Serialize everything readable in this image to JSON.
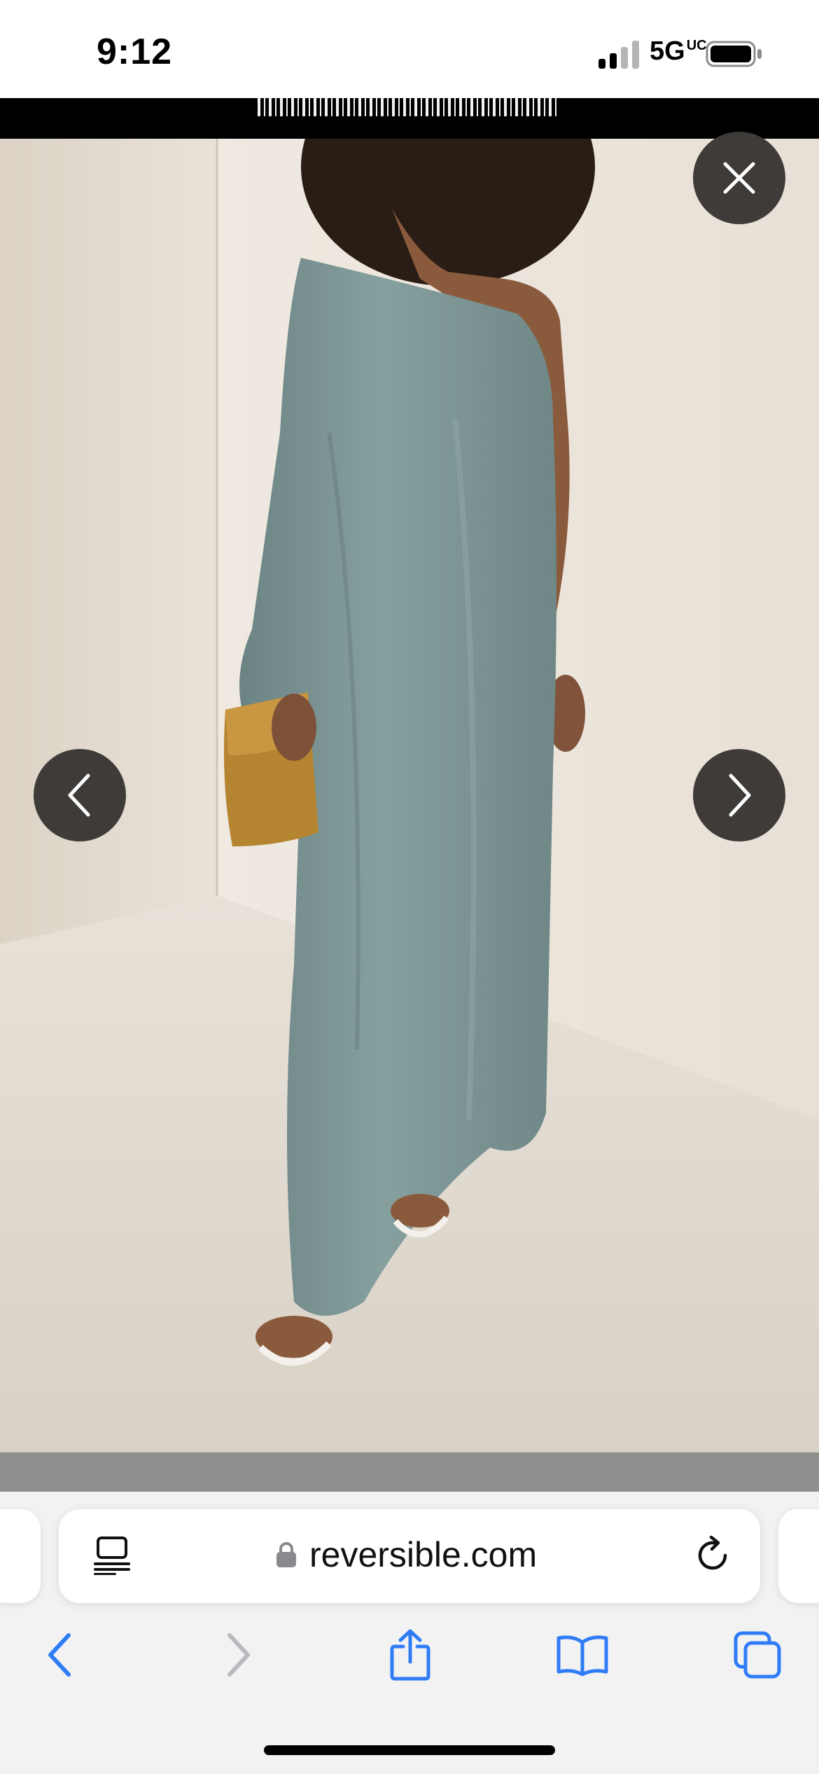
{
  "status_bar": {
    "time": "9:12",
    "network": "5G",
    "network_suffix": "UC",
    "battery_icon": "battery-icon",
    "signal_icon": "cellular-signal-icon"
  },
  "gallery": {
    "image_alt": "Model wearing one-shoulder sage green maxi dress holding a mustard suede clutch",
    "close_icon": "close-icon",
    "prev_icon": "chevron-left-icon",
    "next_icon": "chevron-right-icon"
  },
  "browser": {
    "url": "reversible.com",
    "reader_icon": "reader-mode-icon",
    "lock_icon": "lock-icon",
    "reload_icon": "reload-icon",
    "nav": {
      "back_icon": "back-arrow-icon",
      "forward_icon": "forward-arrow-icon",
      "share_icon": "share-icon",
      "bookmarks_icon": "bookmarks-icon",
      "tabs_icon": "tabs-icon"
    }
  },
  "colors": {
    "accent": "#2f7cf6",
    "disabled": "#b8b8bd",
    "overlay_button": "#3e3b38",
    "dress": "#7e9696",
    "clutch": "#b58431"
  }
}
